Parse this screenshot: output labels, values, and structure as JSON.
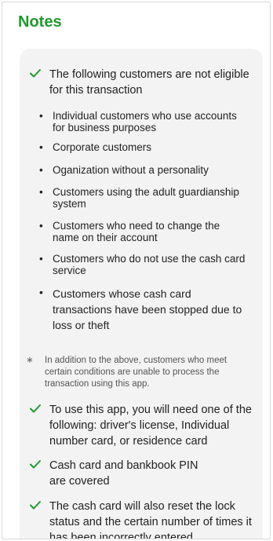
{
  "header": {
    "title": "Notes"
  },
  "intro_item": {
    "text": "The following customers are not eligible for this transaction"
  },
  "ineligible": [
    "Individual customers who use accounts for business purposes",
    "Corporate customers",
    "Oganization without a personality",
    "Customers using the adult guardianship system",
    "Customers who need to change the name on their account",
    "Customers who do not use the cash card service",
    "Customers whose cash card transactions have been stopped due to loss or theft"
  ],
  "note": {
    "mark": "∗",
    "text": "In addition to the above, customers who meet certain conditions are unable to process the transaction using this app."
  },
  "requirements": [
    "To use this app, you will need one of the following: driver's license, Individual number card, or residence card",
    "Cash card and bankbook PIN are covered",
    "The cash card will also reset the lock status and the certain number of times it has been incorrectly entered"
  ],
  "colors": {
    "accent": "#1f9a2b",
    "card": "#f3f3f3"
  },
  "icons": {
    "check": "check-icon",
    "bullet": "bullet-dot-icon"
  }
}
